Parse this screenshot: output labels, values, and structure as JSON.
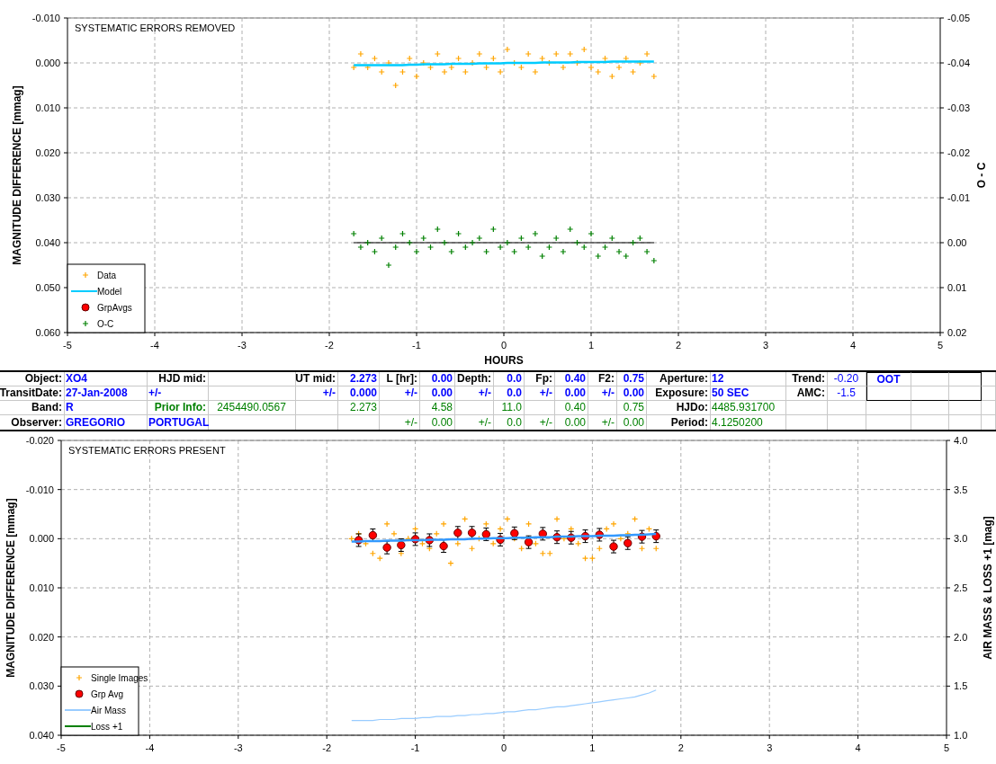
{
  "top_chart": {
    "title": "SYSTEMATIC ERRORS REMOVED",
    "chart_data": {
      "type": "scatter",
      "grid": true,
      "legend": true,
      "xlabel": "HOURS",
      "ylabel": "MAGNITUDE DIFFERENCE [mmag]",
      "y2label": "O - C",
      "xlim": [
        -5,
        5
      ],
      "ylim": [
        0.06,
        -0.01
      ],
      "y2lim": [
        0.02,
        -0.05
      ],
      "xticks": [
        -5,
        -4,
        -3,
        -2,
        -1,
        0,
        1,
        2,
        3,
        4,
        5
      ],
      "yticks": [
        {
          "value": -0.01,
          "label": "-0.010"
        },
        {
          "value": 0,
          "label": "0.000"
        },
        {
          "value": 0.01,
          "label": "0.010"
        },
        {
          "value": 0.02,
          "label": "0.020"
        },
        {
          "value": 0.03,
          "label": "0.030"
        },
        {
          "value": 0.04,
          "label": "0.040"
        },
        {
          "value": 0.05,
          "label": "0.050"
        },
        {
          "value": 0.06,
          "label": "0.060"
        }
      ],
      "y2ticks": [
        {
          "value": -0.05,
          "label": "-0.05"
        },
        {
          "value": -0.04,
          "label": "-0.04"
        },
        {
          "value": -0.03,
          "label": "-0.03"
        },
        {
          "value": -0.02,
          "label": "-0.02"
        },
        {
          "value": -0.01,
          "label": "-0.01"
        },
        {
          "value": 0,
          "label": "0.00"
        },
        {
          "value": 0.01,
          "label": "0.01"
        },
        {
          "value": 0.02,
          "label": "0.02"
        }
      ],
      "ref_lines": [
        {
          "axis": "y2",
          "value": 0,
          "color": "#000000"
        }
      ],
      "x": [
        -1.72,
        -1.64,
        -1.56,
        -1.48,
        -1.4,
        -1.32,
        -1.24,
        -1.16,
        -1.08,
        -1.0,
        -0.92,
        -0.84,
        -0.76,
        -0.68,
        -0.6,
        -0.52,
        -0.44,
        -0.36,
        -0.28,
        -0.2,
        -0.12,
        -0.04,
        0.04,
        0.12,
        0.2,
        0.28,
        0.36,
        0.44,
        0.52,
        0.6,
        0.68,
        0.76,
        0.84,
        0.92,
        1.0,
        1.08,
        1.16,
        1.24,
        1.32,
        1.4,
        1.48,
        1.56,
        1.64,
        1.72
      ],
      "series": [
        {
          "name": "Data",
          "type": "scatter",
          "marker": "plus",
          "color": "#ffa500",
          "values": [
            0.001,
            -0.002,
            0.001,
            -0.001,
            0.002,
            0.0,
            0.005,
            0.002,
            -0.001,
            0.003,
            0.0,
            0.001,
            -0.002,
            0.002,
            0.001,
            -0.001,
            0.002,
            0.0,
            -0.002,
            0.001,
            -0.001,
            0.002,
            -0.003,
            0.0,
            0.001,
            -0.002,
            0.002,
            -0.001,
            0.0,
            -0.002,
            0.001,
            -0.002,
            0.0,
            -0.003,
            0.001,
            0.002,
            -0.001,
            0.003,
            0.001,
            -0.001,
            0.002,
            0.0,
            -0.002,
            0.003
          ]
        },
        {
          "name": "Model",
          "type": "line",
          "color": "#00ccff",
          "values": [
            0.0005,
            0.0005,
            0.0005,
            0.0005,
            0.0005,
            0.0005,
            0.0005,
            0.0005,
            0.0004,
            0.0004,
            0.0003,
            0.0003,
            0.0003,
            0.0003,
            0.0002,
            0.0002,
            0.0002,
            0.0002,
            0.0001,
            0.0001,
            0.0001,
            0.0001,
            0.0,
            0.0,
            0.0,
            0.0,
            0.0,
            -0.0001,
            -0.0001,
            -0.0001,
            -0.0001,
            -0.0001,
            -0.0002,
            -0.0002,
            -0.0002,
            -0.0002,
            -0.0002,
            -0.0003,
            -0.0003,
            -0.0003,
            -0.0003,
            -0.0003,
            -0.0003,
            -0.0003
          ]
        },
        {
          "name": "GrpAvgs",
          "type": "scatter",
          "marker": "circle",
          "color": "#ff0000",
          "values": [
            null,
            null,
            null,
            null,
            null,
            null,
            null,
            null,
            null,
            null,
            null,
            null,
            null,
            null,
            null,
            null,
            null,
            null,
            null,
            null,
            null,
            null,
            null,
            null,
            null,
            null,
            null,
            null,
            null,
            null,
            null,
            null,
            null,
            null,
            null,
            null,
            null,
            null,
            null,
            null,
            null,
            null,
            null,
            null
          ]
        },
        {
          "name": "O-C",
          "type": "scatter",
          "marker": "plus",
          "axis": "y2",
          "color": "#008000",
          "values": [
            -0.002,
            0.001,
            0.0,
            0.002,
            -0.001,
            0.005,
            0.001,
            -0.002,
            0.0,
            0.002,
            -0.001,
            0.001,
            -0.003,
            0.0,
            0.002,
            -0.002,
            0.001,
            0.0,
            -0.001,
            0.002,
            -0.003,
            0.001,
            0.0,
            0.002,
            -0.001,
            0.001,
            -0.002,
            0.003,
            0.001,
            -0.001,
            0.002,
            -0.003,
            0.0,
            0.001,
            -0.002,
            0.003,
            0.001,
            -0.001,
            0.002,
            0.003,
            0.0,
            -0.001,
            0.002,
            0.004
          ]
        }
      ]
    }
  },
  "data_table": {
    "rows": [
      [
        {
          "text": "Object:",
          "kind": "label"
        },
        {
          "text": "XO4",
          "kind": "input"
        },
        {
          "text": "HJD mid:",
          "kind": "label"
        },
        null,
        {
          "text": "UT mid:",
          "kind": "label"
        },
        {
          "text": "2.273",
          "kind": "input"
        },
        {
          "text": "L [hr]:",
          "kind": "label"
        },
        {
          "text": "0.00",
          "kind": "input"
        },
        {
          "text": "Depth:",
          "kind": "label"
        },
        {
          "text": "0.0",
          "kind": "input"
        },
        {
          "text": "Fp:",
          "kind": "label"
        },
        {
          "text": "0.40",
          "kind": "input"
        },
        {
          "text": "F2:",
          "kind": "label"
        },
        {
          "text": "0.75",
          "kind": "input"
        },
        {
          "text": "Aperture:",
          "kind": "label"
        },
        {
          "text": "12",
          "kind": "input"
        },
        {
          "text": "Trend:",
          "kind": "label"
        },
        {
          "text": "-0.20",
          "kind": "input-light"
        },
        {
          "text": "OOT",
          "kind": "input"
        },
        null,
        null
      ],
      [
        {
          "text": "TransitDate:",
          "kind": "label"
        },
        {
          "text": "27-Jan-2008",
          "kind": "input"
        },
        {
          "text": "+/-",
          "kind": "input"
        },
        null,
        {
          "text": "+/-",
          "kind": "input"
        },
        {
          "text": "0.000",
          "kind": "input"
        },
        {
          "text": "+/-",
          "kind": "input"
        },
        {
          "text": "0.00",
          "kind": "input"
        },
        {
          "text": "+/-",
          "kind": "input"
        },
        {
          "text": "0.0",
          "kind": "input"
        },
        {
          "text": "+/-",
          "kind": "input"
        },
        {
          "text": "0.00",
          "kind": "input"
        },
        {
          "text": "+/-",
          "kind": "input"
        },
        {
          "text": "0.00",
          "kind": "input"
        },
        {
          "text": "Exposure:",
          "kind": "label"
        },
        {
          "text": "50 SEC",
          "kind": "input"
        },
        {
          "text": "AMC:",
          "kind": "label"
        },
        {
          "text": "-1.5",
          "kind": "input-light"
        },
        null,
        null,
        null
      ],
      [
        {
          "text": "Band:",
          "kind": "label"
        },
        {
          "text": "R",
          "kind": "input"
        },
        {
          "text": "Prior Info:",
          "kind": "prior-label"
        },
        {
          "text": "2454490.0567",
          "kind": "prior"
        },
        null,
        {
          "text": "2.273",
          "kind": "prior"
        },
        null,
        {
          "text": "4.58",
          "kind": "prior"
        },
        null,
        {
          "text": "11.0",
          "kind": "prior"
        },
        null,
        {
          "text": "0.40",
          "kind": "prior"
        },
        null,
        {
          "text": "0.75",
          "kind": "prior"
        },
        {
          "text": "HJDo:",
          "kind": "label"
        },
        {
          "text": "4485.931700",
          "kind": "prior"
        },
        null,
        null,
        null,
        null,
        null
      ],
      [
        {
          "text": "Observer:",
          "kind": "label"
        },
        {
          "text": "GREGORIO",
          "kind": "input"
        },
        {
          "text": "PORTUGAL",
          "kind": "input"
        },
        null,
        null,
        null,
        {
          "text": "+/-",
          "kind": "prior"
        },
        {
          "text": "0.00",
          "kind": "prior"
        },
        {
          "text": "+/-",
          "kind": "prior"
        },
        {
          "text": "0.0",
          "kind": "prior"
        },
        {
          "text": "+/-",
          "kind": "prior"
        },
        {
          "text": "0.00",
          "kind": "prior"
        },
        {
          "text": "+/-",
          "kind": "prior"
        },
        {
          "text": "0.00",
          "kind": "prior"
        },
        {
          "text": "Period:",
          "kind": "label"
        },
        {
          "text": "4.1250200",
          "kind": "prior"
        },
        null,
        null,
        null,
        null,
        null
      ]
    ]
  },
  "bottom_chart": {
    "title": "SYSTEMATIC ERRORS PRESENT",
    "chart_data": {
      "type": "scatter",
      "grid": true,
      "legend": true,
      "ylabel": "MAGNITUDE DIFFERENCE [mmag]",
      "y2label": "AIR MASS & LOSS +1 [mag]",
      "xlim": [
        -5,
        5
      ],
      "ylim": [
        0.04,
        -0.02
      ],
      "y2lim": [
        1.0,
        4.0
      ],
      "xticks": [
        -5,
        -4,
        -3,
        -2,
        -1,
        0,
        1,
        2,
        3,
        4,
        5
      ],
      "yticks": [
        {
          "value": -0.02,
          "label": "-0.020"
        },
        {
          "value": -0.01,
          "label": "-0.010"
        },
        {
          "value": 0,
          "label": "0.000"
        },
        {
          "value": 0.01,
          "label": "0.010"
        },
        {
          "value": 0.02,
          "label": "0.020"
        },
        {
          "value": 0.03,
          "label": "0.030"
        },
        {
          "value": 0.04,
          "label": "0.040"
        }
      ],
      "y2ticks": [
        {
          "value": 1.0,
          "label": "1.0"
        },
        {
          "value": 1.5,
          "label": "1.5"
        },
        {
          "value": 2.0,
          "label": "2.0"
        },
        {
          "value": 2.5,
          "label": "2.5"
        },
        {
          "value": 3.0,
          "label": "3.0"
        },
        {
          "value": 3.5,
          "label": "3.5"
        },
        {
          "value": 4.0,
          "label": "4.0"
        }
      ],
      "x": [
        -1.72,
        -1.64,
        -1.56,
        -1.48,
        -1.4,
        -1.32,
        -1.24,
        -1.16,
        -1.08,
        -1.0,
        -0.92,
        -0.84,
        -0.76,
        -0.68,
        -0.6,
        -0.52,
        -0.44,
        -0.36,
        -0.28,
        -0.2,
        -0.12,
        -0.04,
        0.04,
        0.12,
        0.2,
        0.28,
        0.36,
        0.44,
        0.52,
        0.6,
        0.68,
        0.76,
        0.84,
        0.92,
        1.0,
        1.08,
        1.16,
        1.24,
        1.32,
        1.4,
        1.48,
        1.56,
        1.64,
        1.72
      ],
      "series": [
        {
          "name": "Single Images",
          "type": "scatter",
          "marker": "plus",
          "color": "#ffa500",
          "values": [
            0.0,
            -0.001,
            0.001,
            0.003,
            0.004,
            -0.003,
            -0.001,
            0.003,
            0.0,
            -0.002,
            0.001,
            0.002,
            -0.001,
            -0.003,
            0.005,
            0.001,
            -0.004,
            0.002,
            0.0,
            -0.003,
            0.001,
            -0.002,
            -0.004,
            0.0,
            0.002,
            -0.003,
            0.001,
            0.003,
            0.003,
            -0.004,
            0.0,
            -0.002,
            0.001,
            0.004,
            0.004,
            0.002,
            -0.002,
            -0.003,
            0.0,
            -0.001,
            -0.004,
            0.002,
            -0.002,
            0.002
          ]
        },
        {
          "name": "Grp Avg",
          "type": "scatter",
          "marker": "circle",
          "color": "#ff0000",
          "values": [
            null,
            0.0003,
            null,
            -0.0007,
            null,
            0.0018,
            null,
            0.0013,
            null,
            0.0001,
            null,
            0.0003,
            null,
            0.0015,
            null,
            -0.0012,
            null,
            -0.0012,
            null,
            -0.0009,
            null,
            0.0002,
            null,
            -0.0011,
            null,
            0.0007,
            null,
            -0.001,
            null,
            -0.0003,
            null,
            -0.0002,
            null,
            -0.0005,
            null,
            -0.0008,
            null,
            0.0016,
            null,
            0.0009,
            null,
            -0.0004,
            null,
            -0.0005
          ]
        },
        {
          "name": "Air Mass",
          "type": "line",
          "axis": "y2",
          "color": "#99ccff",
          "values": [
            1.15,
            1.15,
            1.15,
            1.15,
            1.16,
            1.16,
            1.16,
            1.17,
            1.17,
            1.17,
            1.18,
            1.18,
            1.19,
            1.19,
            1.19,
            1.2,
            1.2,
            1.21,
            1.21,
            1.22,
            1.22,
            1.23,
            1.24,
            1.24,
            1.25,
            1.26,
            1.26,
            1.27,
            1.28,
            1.29,
            1.29,
            1.3,
            1.31,
            1.32,
            1.33,
            1.34,
            1.35,
            1.36,
            1.37,
            1.38,
            1.39,
            1.41,
            1.43,
            1.46
          ]
        },
        {
          "name": "Loss +1",
          "type": "line",
          "color": "#008000",
          "values": [
            null,
            null,
            null,
            null,
            null,
            null,
            null,
            null,
            null,
            null,
            null,
            null,
            null,
            null,
            null,
            null,
            null,
            null,
            null,
            null,
            null,
            null,
            null,
            null,
            null,
            null,
            null,
            null,
            null,
            null,
            null,
            null,
            null,
            null,
            null,
            null,
            null,
            null,
            null,
            null,
            null,
            null,
            null,
            null
          ]
        },
        {
          "type": "line",
          "color": "#3399ff",
          "values": [
            0.0006,
            0.0006,
            0.0005,
            0.0005,
            0.0005,
            0.0004,
            0.0004,
            0.0004,
            0.0003,
            0.0003,
            0.0003,
            0.0002,
            0.0002,
            0.0002,
            0.0001,
            0.0001,
            0.0001,
            0.0,
            0.0,
            0.0,
            -0.0001,
            -0.0001,
            -0.0001,
            -0.0002,
            -0.0002,
            -0.0002,
            -0.0003,
            -0.0003,
            -0.0003,
            -0.0004,
            -0.0004,
            -0.0004,
            -0.0005,
            -0.0005,
            -0.0005,
            -0.0006,
            -0.0006,
            -0.0006,
            -0.0007,
            -0.0007,
            -0.0008,
            -0.0008,
            -0.0009,
            -0.001
          ]
        }
      ]
    }
  }
}
